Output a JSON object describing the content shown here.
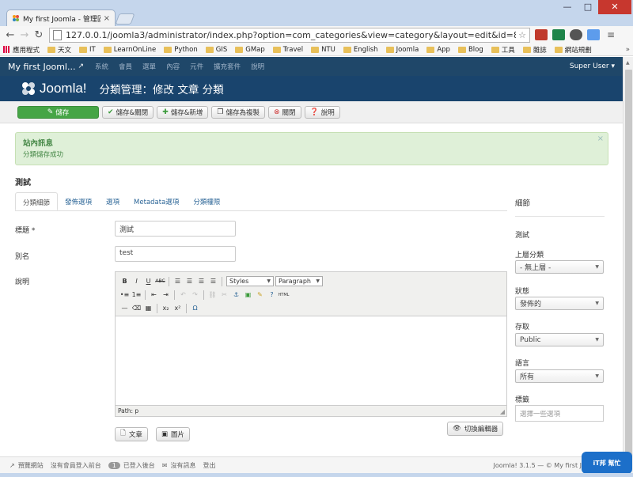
{
  "browser": {
    "tab_title": "My first Joomla - 管理區",
    "tab_close": "×",
    "url": "127.0.0.1/joomla3/administrator/index.php?option=com_categories&view=category&layout=edit&id=8&ex",
    "win_controls": [
      "—",
      "□",
      "✕"
    ],
    "bookmarks": [
      "應用程式",
      "天文",
      "IT",
      "LearnOnLine",
      "Python",
      "GIS",
      "GMap",
      "Travel",
      "NTU",
      "English",
      "Joomla",
      "App",
      "Blog",
      "工具",
      "雜誌",
      "網站規劃"
    ],
    "bookmarks_more": "»"
  },
  "jnav": {
    "brand": "My first Jooml...",
    "items": [
      "系統",
      "會員",
      "選單",
      "內容",
      "元件",
      "擴充套件",
      "說明"
    ],
    "user": "Super User ▾"
  },
  "header": {
    "logo": "Joomla!",
    "title": "分類管理：修改 文章 分類"
  },
  "toolbar": {
    "save": "儲存",
    "save_close": "儲存&關閉",
    "save_new": "儲存&新增",
    "save_copy": "儲存為複製",
    "close": "關閉",
    "help": "說明"
  },
  "message": {
    "title": "站內訊息",
    "body": "分類儲存成功",
    "close": "×"
  },
  "category_name": "測試",
  "tabs": [
    "分類細節",
    "發佈選項",
    "選項",
    "Metadata選項",
    "分類權限"
  ],
  "form": {
    "title_label": "標題 *",
    "title_value": "測試",
    "alias_label": "別名",
    "alias_value": "test",
    "desc_label": "說明"
  },
  "editor": {
    "styles": "Styles",
    "format": "Paragraph",
    "path": "Path: p",
    "btn_article": "文章",
    "btn_image": "圖片",
    "btn_toggle": "切換編輯器",
    "grip": "◢"
  },
  "sidebar": {
    "heading": "細節",
    "category_name": "測試",
    "parent_label": "上層分類",
    "parent_value": "- 無上層 -",
    "status_label": "狀態",
    "status_value": "發佈的",
    "access_label": "存取",
    "access_value": "Public",
    "language_label": "語言",
    "language_value": "所有",
    "tags_label": "標籤",
    "tags_placeholder": "選擇一些選項"
  },
  "status_bar": {
    "view_site": "預覽網站",
    "visitors": "沒有會員登入前台",
    "admins_count": "1",
    "admins": "已登入後台",
    "messages": "沒有訊息",
    "logout": "登出",
    "version": "Joomla! 3.1.5 — © My first J"
  },
  "watermark": "iT邦\n幫忙",
  "colors": {
    "nav_bg": "#1f4769",
    "header_bg": "#19446d",
    "save_green": "#46a546",
    "link_blue": "#2a6496",
    "success_bg": "#dff0d8"
  }
}
